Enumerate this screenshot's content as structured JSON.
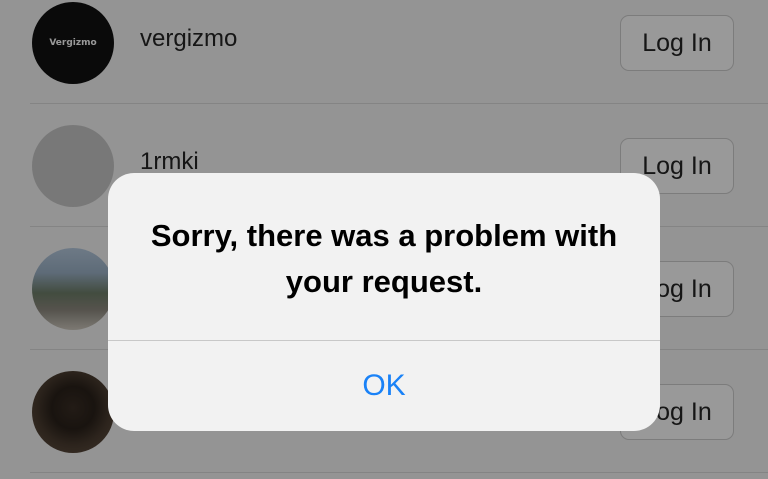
{
  "accounts": [
    {
      "username": "vergizmo",
      "avatar_text": "Vergizmo",
      "avatar_type": "logo",
      "login_label": "Log In"
    },
    {
      "username": "1rmki",
      "avatar_type": "blank",
      "login_label": "Log In"
    },
    {
      "username": "",
      "avatar_type": "group-photo",
      "login_label": "Log In"
    },
    {
      "username": "",
      "avatar_type": "person-photo",
      "login_label": "Log In"
    }
  ],
  "alert": {
    "message": "Sorry, there was a problem with your request.",
    "ok_label": "OK"
  },
  "colors": {
    "ok_text": "#1a82f7",
    "overlay": "rgba(0,0,0,0.40)"
  }
}
